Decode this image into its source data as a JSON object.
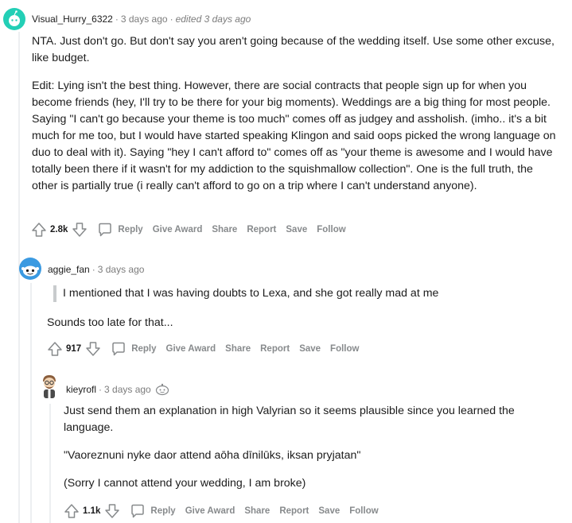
{
  "comments": [
    {
      "username": "Visual_Hurry_6322",
      "time": "3 days ago",
      "edited": "edited 3 days ago",
      "paragraphs": [
        "NTA. Just don't go. But don't say you aren't going because of the wedding itself. Use some other excuse, like budget.",
        "Edit: Lying isn't the best thing. However, there are social contracts that people sign up for when you become friends (hey, I'll try to be there for your big moments). Weddings are a big thing for most people. Saying \"I can't go because your theme is too much\" comes off as judgey and assholish. (imho.. it's a bit much for me too, but I would have started speaking Klingon and said oops picked the wrong language on duo to deal with it). Saying \"hey I can't afford to\" comes off as \"your theme is awesome and I would have totally been there if it wasn't for my addiction to the squishmallow collection\". One is the full truth, the other is partially true (i really can't afford to go on a trip where I can't understand anyone)."
      ],
      "score": "2.8k"
    },
    {
      "username": "aggie_fan",
      "time": "3 days ago",
      "quote": "I mentioned that I was having doubts to Lexa, and she got really mad at me",
      "paragraphs": [
        "Sounds too late for that..."
      ],
      "score": "917"
    },
    {
      "username": "kieyrofl",
      "time": "3 days ago",
      "paragraphs": [
        "Just send them an explanation in high Valyrian so it seems plausible since you learned the language.",
        "\"Vaoreznuni nyke daor attend aōha dīnilūks, iksan pryjatan\"",
        "(Sorry I cannot attend your wedding, I am broke)"
      ],
      "score": "1.1k"
    }
  ],
  "actions": {
    "reply": "Reply",
    "give_award": "Give Award",
    "share": "Share",
    "report": "Report",
    "save": "Save",
    "follow": "Follow"
  },
  "meta_sep": "·",
  "colors": {
    "avatar1": "#23cfb6",
    "avatar2": "#3b9ae1",
    "avatar3": "#d4c1a6",
    "thread_line": "#edeff1",
    "action_text": "#878a8c"
  }
}
